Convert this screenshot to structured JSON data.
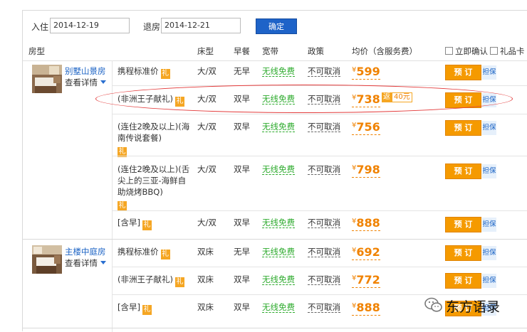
{
  "dates": {
    "checkin_label": "入住",
    "checkin_value": "2014-12-19",
    "checkout_label": "退房",
    "checkout_value": "2014-12-21",
    "confirm_label": "确定"
  },
  "table": {
    "headers": {
      "room": "房型",
      "bed": "床型",
      "breakfast": "早餐",
      "broadband": "宽带",
      "policy": "政策",
      "price": "均价（含服务费）",
      "instant": "立即确认",
      "gift_card": "礼品卡"
    }
  },
  "gift_glyph": "礼",
  "detail_label": "查看详情",
  "book_label": "预 订",
  "group_label": "担保",
  "currency": "¥",
  "groups": [
    {
      "room_name": "别墅山景房",
      "rows": [
        {
          "title": "携程标准价",
          "bed": "大/双",
          "breakfast": "无早",
          "wifi": "无线免费",
          "policy": "不可取消",
          "price": "599"
        },
        {
          "title": "(非洲王子献礼)",
          "bed": "大/双",
          "breakfast": "双早",
          "wifi": "无线免费",
          "policy": "不可取消",
          "price": "738",
          "rebate_prefix": "返",
          "rebate": "40元"
        },
        {
          "title": "(连住2晚及以上)(海南传说套餐)",
          "bed": "大/双",
          "breakfast": "双早",
          "wifi": "无线免费",
          "policy": "不可取消",
          "price": "756"
        },
        {
          "title": "(连住2晚及以上)(舌尖上的三亚-海鲜自助烧烤BBQ)",
          "bed": "大/双",
          "breakfast": "双早",
          "wifi": "无线免费",
          "policy": "不可取消",
          "price": "798"
        },
        {
          "title": "[含早]",
          "bed": "大/双",
          "breakfast": "双早",
          "wifi": "无线免费",
          "policy": "不可取消",
          "price": "888"
        }
      ]
    },
    {
      "room_name": "主楼中庭房",
      "rows": [
        {
          "title": "携程标准价",
          "bed": "双床",
          "breakfast": "无早",
          "wifi": "无线免费",
          "policy": "不可取消",
          "price": "692"
        },
        {
          "title": "(非洲王子献礼)",
          "bed": "双床",
          "breakfast": "双早",
          "wifi": "无线免费",
          "policy": "不可取消",
          "price": "772"
        },
        {
          "title": "[含早]",
          "bed": "双床",
          "breakfast": "双早",
          "wifi": "无线免费",
          "policy": "不可取消",
          "price": "888"
        }
      ]
    }
  ],
  "watermark": {
    "text": "东方语录",
    "icon": "wechat-icon"
  },
  "colors": {
    "link": "#1a62c4",
    "price": "#f08200",
    "book": "#f59a00",
    "wifi": "#2eab2e",
    "highlight": "#e33b3b"
  }
}
